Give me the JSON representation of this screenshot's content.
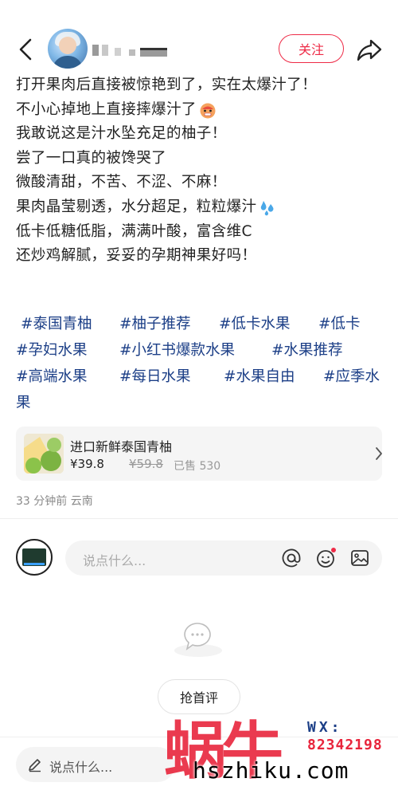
{
  "header": {
    "follow_label": "关注"
  },
  "post": {
    "lines": [
      "打开果肉后直接被惊艳到了，实在太爆汁了！",
      "不小心掉地上直接摔爆汁了",
      "我敢说这是汁水坠充足的柚子！",
      "尝了一口真的被馋哭了",
      "微酸清甜，不苦、不涩、不麻！",
      "果肉晶莹剔透，水分超足，粒粒爆汁",
      "低卡低糖低脂，满满叶酸，富含维C",
      "还炒鸡解腻，妥妥的孕期神果好吗！"
    ],
    "tags": [
      [
        "#泰国青柚",
        "#柚子推荐",
        "#低卡水果",
        "#低卡"
      ],
      [
        "#孕妇水果",
        "#小红书爆款水果",
        "#水果推荐"
      ],
      [
        "#高端水果",
        "#每日水果",
        "#水果自由",
        "#应季水"
      ],
      [
        "果"
      ]
    ]
  },
  "product": {
    "title": "进口新鲜泰国青柚",
    "price": "¥39.8",
    "old_price": "¥59.8",
    "sold": "已售 530"
  },
  "meta": {
    "time_location": "33 分钟前 云南"
  },
  "comment": {
    "placeholder": "说点什么..."
  },
  "first_comment_label": "抢首评",
  "bottom": {
    "placeholder": "说点什么..."
  },
  "watermark": {
    "brand": "蜗牛",
    "wx": "WX:",
    "number": "82342198",
    "site": "hszhiku.com"
  },
  "colors": {
    "accent": "#ee2b47",
    "tag": "#1c3f87"
  }
}
